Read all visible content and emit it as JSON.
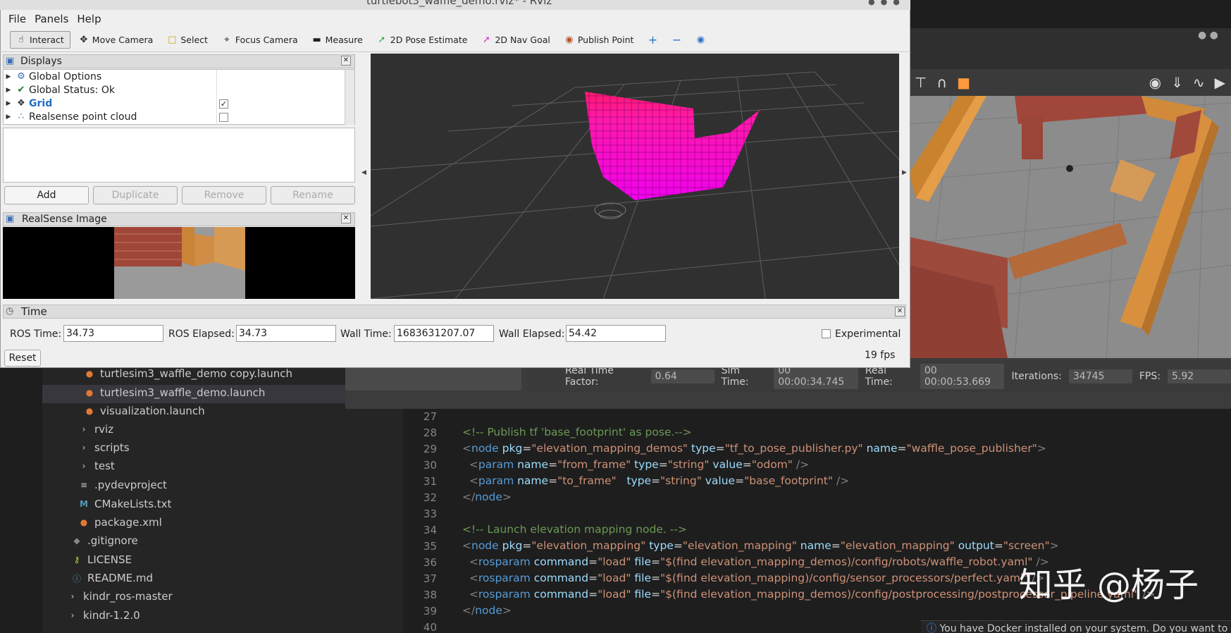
{
  "rviz": {
    "title": "turtlebot3_waffle_demo.rviz* - RViz",
    "menu": [
      "File",
      "Panels",
      "Help"
    ],
    "toolbar": [
      {
        "label": "Interact",
        "icon": "hand-icon"
      },
      {
        "label": "Move Camera",
        "icon": "move-icon"
      },
      {
        "label": "Select",
        "icon": "select-icon"
      },
      {
        "label": "Focus Camera",
        "icon": "focus-icon"
      },
      {
        "label": "Measure",
        "icon": "ruler-icon"
      },
      {
        "label": "2D Pose Estimate",
        "icon": "arrow-green-icon"
      },
      {
        "label": "2D Nav Goal",
        "icon": "arrow-pink-icon"
      },
      {
        "label": "Publish Point",
        "icon": "pin-icon"
      }
    ],
    "displays": {
      "title": "Displays",
      "items": [
        {
          "label": "Global Options"
        },
        {
          "label": "Global Status: Ok"
        },
        {
          "label": "Grid",
          "checked": true
        },
        {
          "label": "Realsense point cloud",
          "checked": false
        }
      ],
      "buttons": [
        "Add",
        "Duplicate",
        "Remove",
        "Rename"
      ]
    },
    "realsense": {
      "title": "RealSense Image"
    },
    "time": {
      "title": "Time",
      "ros_time_label": "ROS Time:",
      "ros_time": "34.73",
      "ros_elapsed_label": "ROS Elapsed:",
      "ros_elapsed": "34.73",
      "wall_time_label": "Wall Time:",
      "wall_time": "1683631207.07",
      "wall_elapsed_label": "Wall Elapsed:",
      "wall_elapsed": "54.42",
      "experimental": "Experimental",
      "fps": "19 fps",
      "reset": "Reset"
    }
  },
  "gazebo": {
    "rtf_label": "Real Time Factor:",
    "rtf": "0.64",
    "sim_label": "Sim Time:",
    "sim": "00 00:00:34.745",
    "real_label": "Real Time:",
    "real": "00 00:00:53.669",
    "iter_label": "Iterations:",
    "iter": "34745",
    "fps_label": "FPS:",
    "fps": "5.92"
  },
  "explorer": {
    "items": [
      {
        "label": "turtlesim3_waffle_demo copy.launch",
        "icon": "rss-icon"
      },
      {
        "label": "turtlesim3_waffle_demo.launch",
        "icon": "rss-icon"
      },
      {
        "label": "visualization.launch",
        "icon": "rss-icon"
      },
      {
        "label": "rviz",
        "icon": "chevron-right-icon"
      },
      {
        "label": "scripts",
        "icon": "chevron-right-icon"
      },
      {
        "label": "test",
        "icon": "chevron-right-icon"
      },
      {
        "label": ".pydevproject",
        "icon": "lines-icon"
      },
      {
        "label": "CMakeLists.txt",
        "icon": "m-icon"
      },
      {
        "label": "package.xml",
        "icon": "rss-icon"
      },
      {
        "label": ".gitignore",
        "icon": "diamond-icon"
      },
      {
        "label": "LICENSE",
        "icon": "key-icon"
      },
      {
        "label": "README.md",
        "icon": "info-icon"
      },
      {
        "label": "kindr_ros-master",
        "icon": "chevron-right-icon"
      },
      {
        "label": "kindr-1.2.0",
        "icon": "chevron-right-icon"
      }
    ]
  },
  "editor": {
    "line_numbers": [
      "27",
      "28",
      "29",
      "30",
      "31",
      "32",
      "33",
      "34",
      "35",
      "36",
      "37",
      "38",
      "39",
      "40"
    ]
  },
  "watermark": "知乎 @杨子",
  "notification": "You have Docker installed on your system. Do you want to"
}
